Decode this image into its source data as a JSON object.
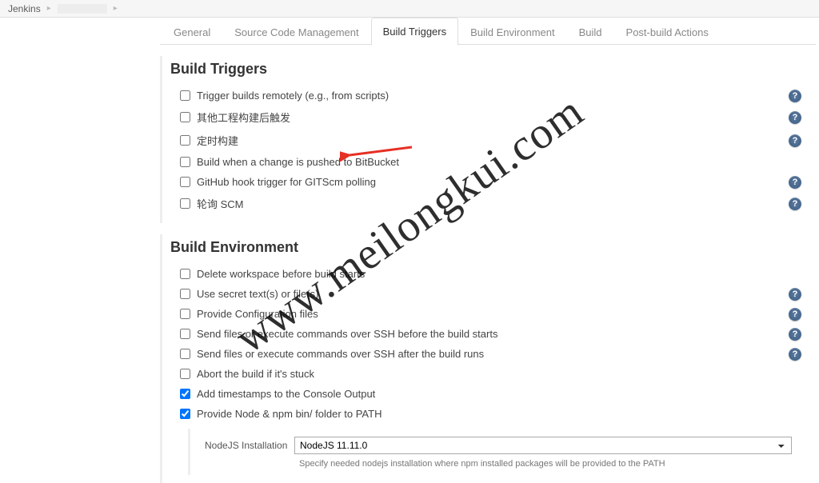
{
  "breadcrumb": {
    "root": "Jenkins"
  },
  "tabs": [
    {
      "label": "General",
      "active": false
    },
    {
      "label": "Source Code Management",
      "active": false
    },
    {
      "label": "Build Triggers",
      "active": true
    },
    {
      "label": "Build Environment",
      "active": false
    },
    {
      "label": "Build",
      "active": false
    },
    {
      "label": "Post-build Actions",
      "active": false
    }
  ],
  "buildTriggers": {
    "title": "Build Triggers",
    "items": [
      {
        "label": "Trigger builds remotely (e.g., from scripts)",
        "checked": false,
        "help": true
      },
      {
        "label": "其他工程构建后触发",
        "checked": false,
        "help": true
      },
      {
        "label": "定时构建",
        "checked": false,
        "help": true
      },
      {
        "label": "Build when a change is pushed to BitBucket",
        "checked": false,
        "help": false,
        "annotated": true
      },
      {
        "label": "GitHub hook trigger for GITScm polling",
        "checked": false,
        "help": true
      },
      {
        "label": "轮询 SCM",
        "checked": false,
        "help": true
      }
    ]
  },
  "buildEnvironment": {
    "title": "Build Environment",
    "items": [
      {
        "label": "Delete workspace before build starts",
        "checked": false,
        "help": false
      },
      {
        "label": "Use secret text(s) or file(s)",
        "checked": false,
        "help": true
      },
      {
        "label": "Provide Configuration files",
        "checked": false,
        "help": true
      },
      {
        "label": "Send files or execute commands over SSH before the build starts",
        "checked": false,
        "help": true
      },
      {
        "label": "Send files or execute commands over SSH after the build runs",
        "checked": false,
        "help": true
      },
      {
        "label": "Abort the build if it's stuck",
        "checked": false,
        "help": false
      },
      {
        "label": "Add timestamps to the Console Output",
        "checked": true,
        "help": false
      },
      {
        "label": "Provide Node & npm bin/ folder to PATH",
        "checked": true,
        "help": false
      }
    ],
    "nodejs": {
      "label": "NodeJS Installation",
      "value": "NodeJS 11.11.0",
      "desc": "Specify needed nodejs installation where npm installed packages will be provided to the PATH"
    }
  },
  "watermark": "www.meilongkui.com",
  "helpGlyph": "?"
}
